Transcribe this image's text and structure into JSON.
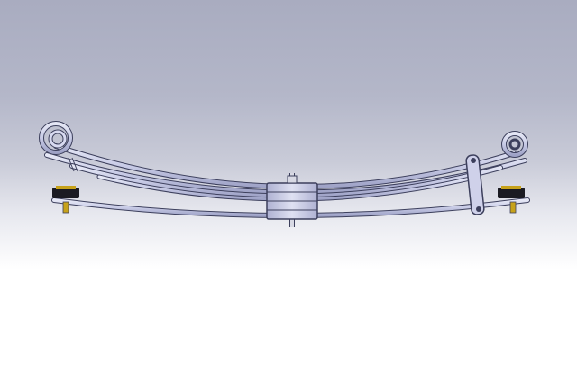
{
  "scene": {
    "subject": "leaf-spring-assembly",
    "colors": {
      "bg_top": "#a9acc0",
      "bg_bottom": "#ffffff",
      "leaf_fill": "#c8cbe6",
      "leaf_edge": "#3c3f5c",
      "leaf_shade": "#9ea2c6",
      "bushing_dark": "#1b1b22",
      "bushing_accent": "#c7a21a",
      "bolt_fill": "#d8d9e4"
    },
    "icons": [
      "eye-coil-left",
      "eye-coil-right",
      "center-clamp",
      "shackle",
      "rubber-bumper-left",
      "rubber-bumper-right"
    ]
  }
}
